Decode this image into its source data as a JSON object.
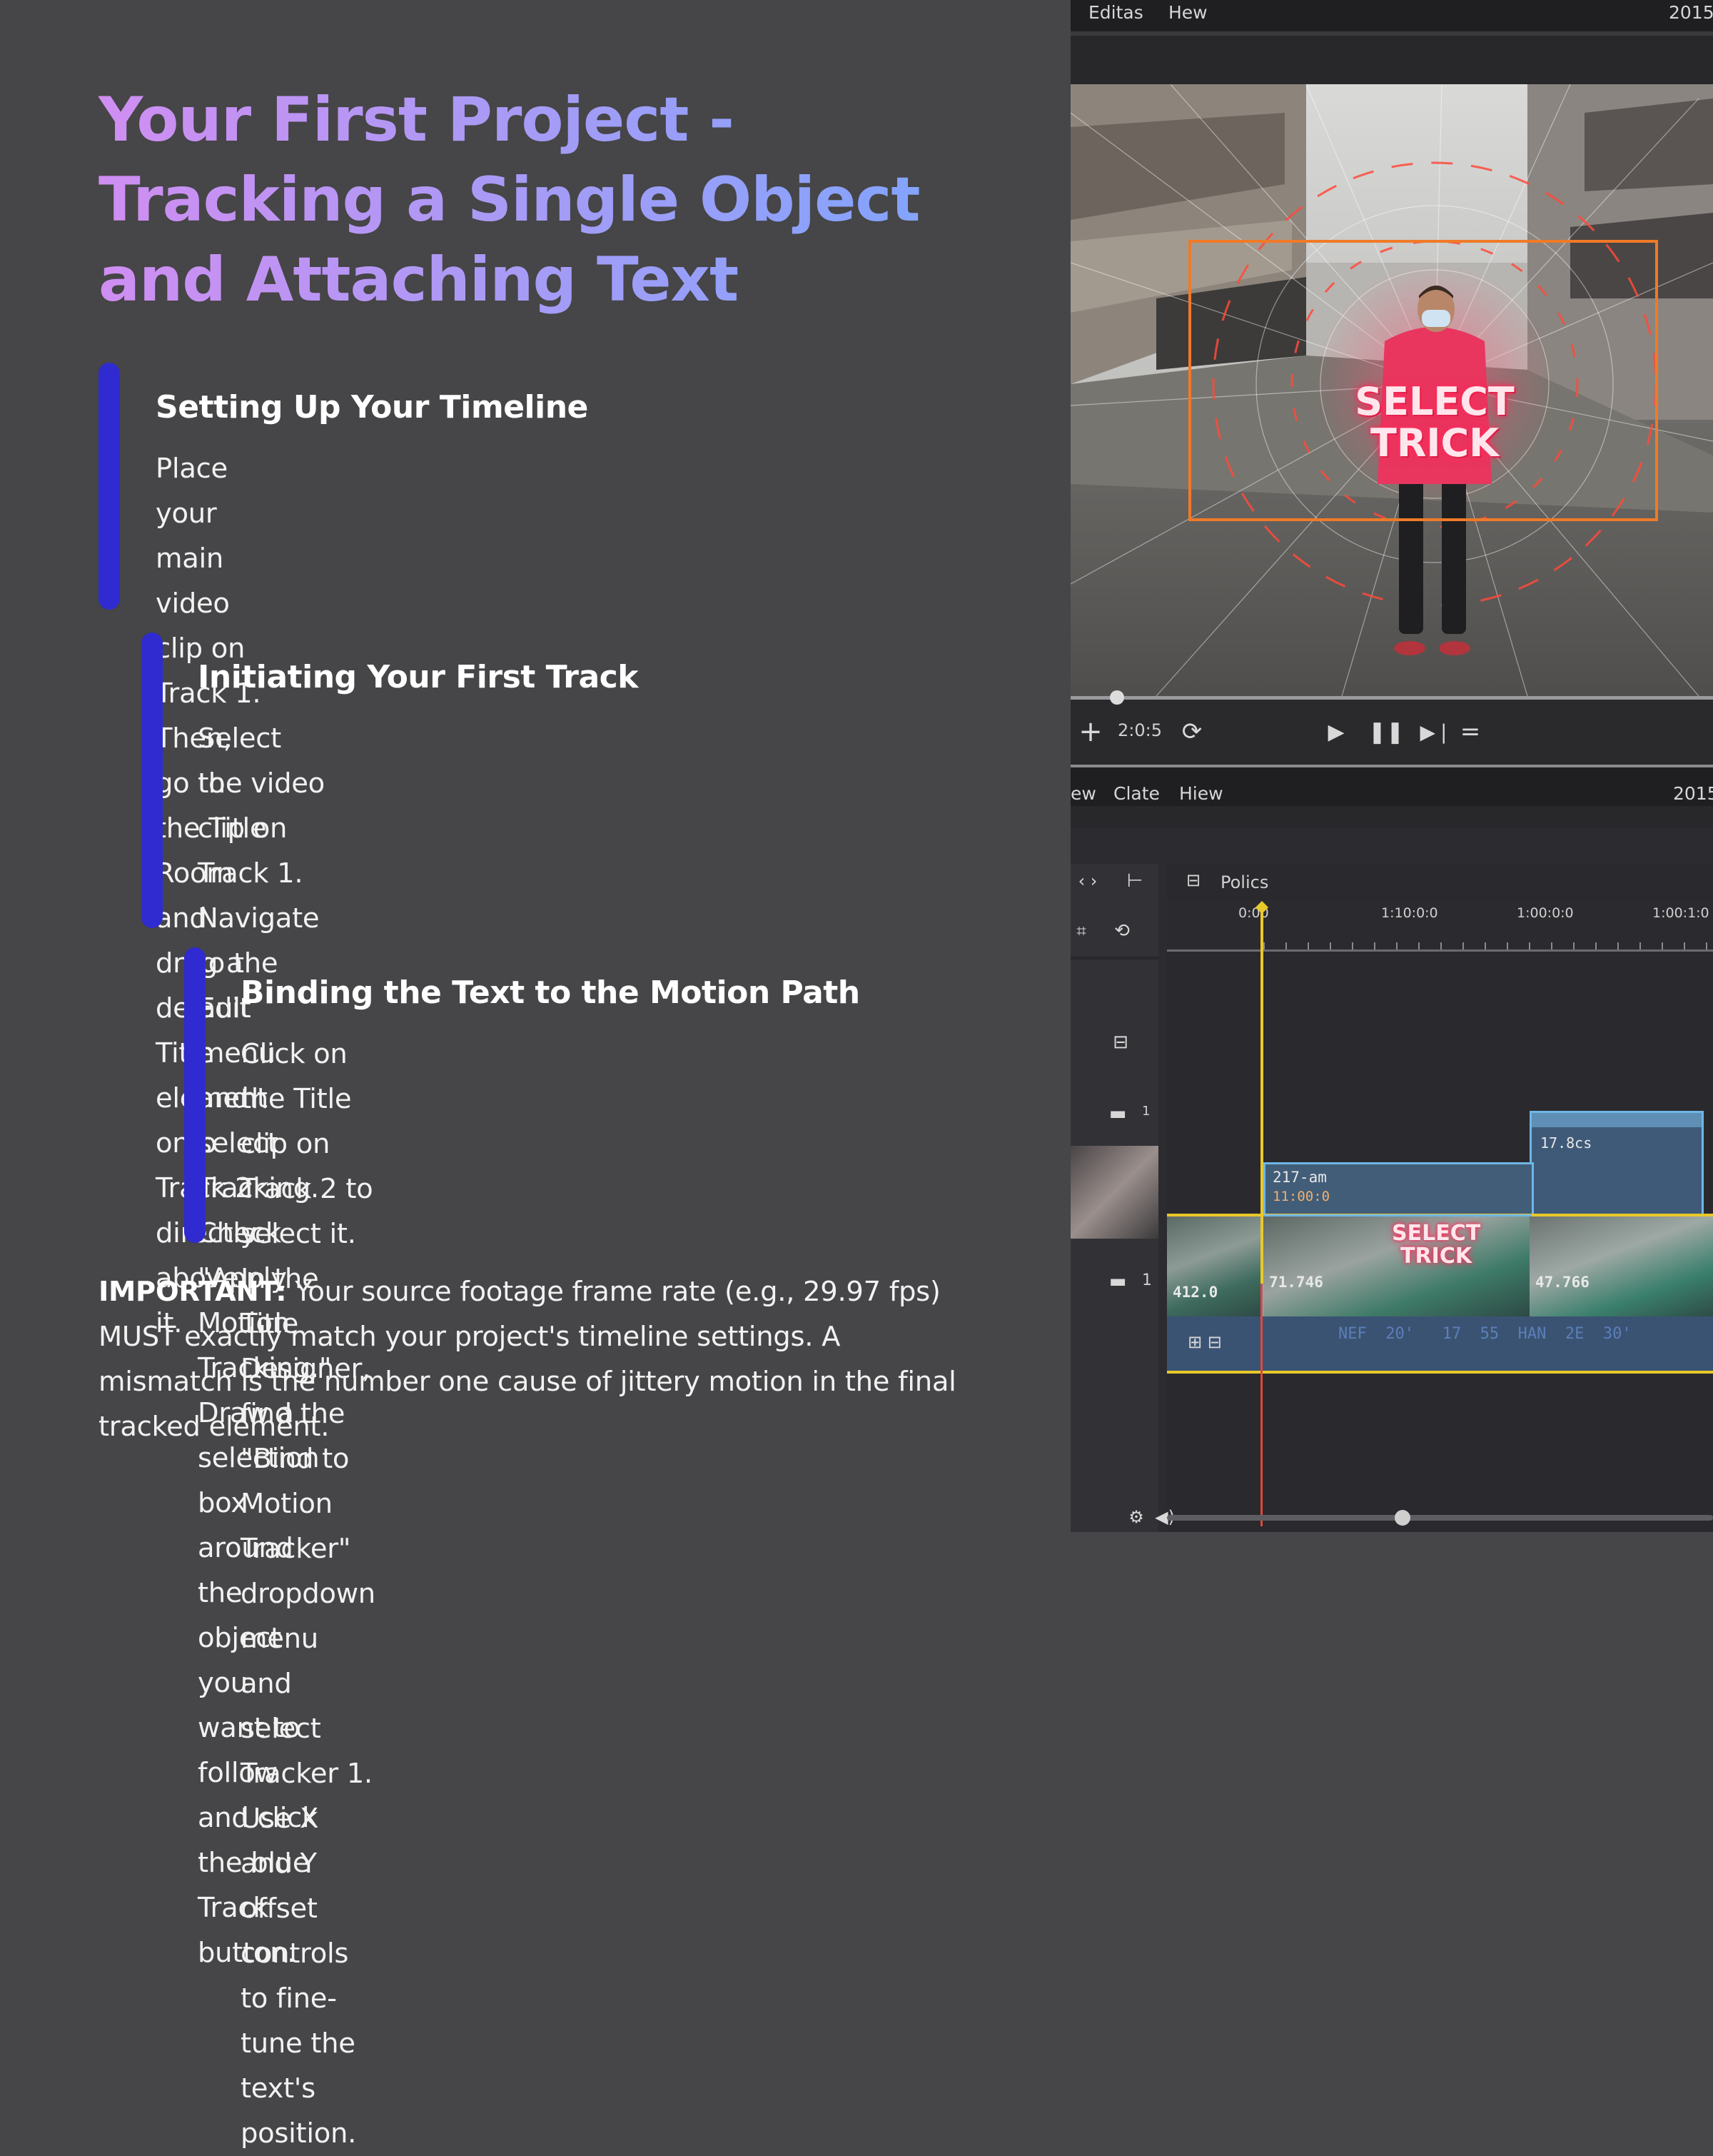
{
  "article": {
    "title_lines": [
      "Your First Project -",
      "Tracking a Single Object",
      "and Attaching Text"
    ],
    "steps": [
      {
        "heading": "Setting Up Your Timeline",
        "lines": [
          "Place your main video clip on Track 1. Then, go to the Title",
          "Room and drag a default Title element onto Track 2 directly",
          "above it."
        ]
      },
      {
        "heading": "Initiating Your First Track",
        "lines": [
          "Select the video clip on Track 1. Navigate to the Edit",
          "menu and select Tracking. Check \"Apply Motion",
          "Tracking.\" Draw a selection box around the object you",
          "want to follow and click the blue Track button."
        ]
      },
      {
        "heading": "Binding the Text to the Motion Path",
        "lines": [
          "Click on the Title clip on Track 2 to select it. In the",
          "Title Designer, find the \"Bind to Motion Tracker\"",
          "dropdown menu and select Tracker 1. Use X and Y",
          "offset controls to fine-tune the text's position."
        ]
      }
    ],
    "important_label": "IMPORTANT:",
    "important_lines": [
      " Your source footage frame rate (e.g., 29.97 fps)",
      "MUST exactly match your project's timeline settings. A",
      "mismatch is the number one cause of jittery motion in the final",
      "tracked element."
    ]
  },
  "editor": {
    "menu_top": {
      "items": [
        "Editas",
        "Hew"
      ],
      "right": "2015"
    },
    "viewer": {
      "overlay_line1": "SELECT",
      "overlay_line2": "TRICK"
    },
    "transport": {
      "timecode": "2:0:5",
      "icons": [
        "plus-icon",
        "loop-icon",
        "play-icon",
        "pause-icon",
        "step-forward-icon",
        "menu-icon"
      ]
    },
    "menu_mid": {
      "items": [
        "ew",
        "Clate",
        "Hiew"
      ],
      "right": "2015"
    },
    "timeline": {
      "panel_title": "Polics",
      "ruler": [
        "0:00",
        "1:10:0:0",
        "1:00:0:0",
        "1:00:1:0"
      ],
      "title_clip_top": {
        "line1": "17.8cs"
      },
      "title_clip": {
        "line1": "217-am",
        "line2": "11:00:0"
      },
      "video_clips": [
        "412.0",
        "71.746",
        "47.766"
      ],
      "video_overlay_line1": "SELECT",
      "video_overlay_line2": "TRICK",
      "audio_track_text": "NEF  20'   17  55  HAN  2E  30'",
      "track_numbers": [
        "1",
        "1"
      ]
    },
    "colors": {
      "accent_bar": "#2f2bd0",
      "tracking_box": "#f07a28",
      "playhead": "#e9c82a",
      "selection": "#6fb6e6"
    }
  }
}
